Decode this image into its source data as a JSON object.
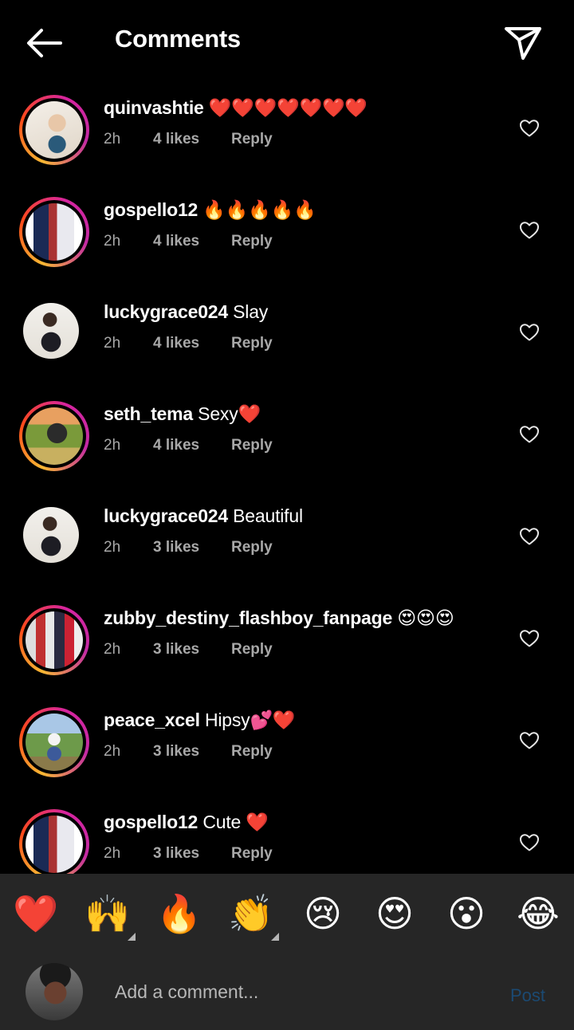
{
  "header": {
    "title": "Comments",
    "back_icon": "arrow-left-icon",
    "send_icon": "paper-plane-icon"
  },
  "comments": [
    {
      "username": "quinvashtie",
      "text": " ❤️❤️❤️❤️❤️❤️❤️",
      "time": "2h",
      "likes": "4 likes",
      "reply": "Reply",
      "story_ring": true
    },
    {
      "username": "gospello12",
      "text": " 🔥🔥🔥🔥🔥",
      "time": "2h",
      "likes": "4 likes",
      "reply": "Reply",
      "story_ring": true
    },
    {
      "username": "luckygrace024",
      "text": " Slay",
      "time": "2h",
      "likes": "4 likes",
      "reply": "Reply",
      "story_ring": false
    },
    {
      "username": "seth_tema",
      "text": " Sexy❤️",
      "time": "2h",
      "likes": "4 likes",
      "reply": "Reply",
      "story_ring": true
    },
    {
      "username": "luckygrace024",
      "text": " Beautiful",
      "time": "2h",
      "likes": "3 likes",
      "reply": "Reply",
      "story_ring": false
    },
    {
      "username": "zubby_destiny_flashboy_fanpage",
      "text": " 😍😍😍",
      "time": "2h",
      "likes": "3 likes",
      "reply": "Reply",
      "story_ring": true
    },
    {
      "username": "peace_xcel",
      "text": " Hipsy💕❤️",
      "time": "2h",
      "likes": "3 likes",
      "reply": "Reply",
      "story_ring": true
    },
    {
      "username": "gospello12",
      "text": " Cute ❤️",
      "time": "2h",
      "likes": "3 likes",
      "reply": "Reply",
      "story_ring": true
    }
  ],
  "emoji_bar": [
    "❤️",
    "🙌",
    "🔥",
    "👏",
    "😢",
    "😍",
    "😮",
    "😂"
  ],
  "composer": {
    "placeholder": "Add a comment...",
    "post_label": "Post"
  },
  "colors": {
    "background": "#000000",
    "bottom_panel": "#262626",
    "meta_text": "#a8a8a8",
    "post_disabled": "#1b4a73"
  }
}
